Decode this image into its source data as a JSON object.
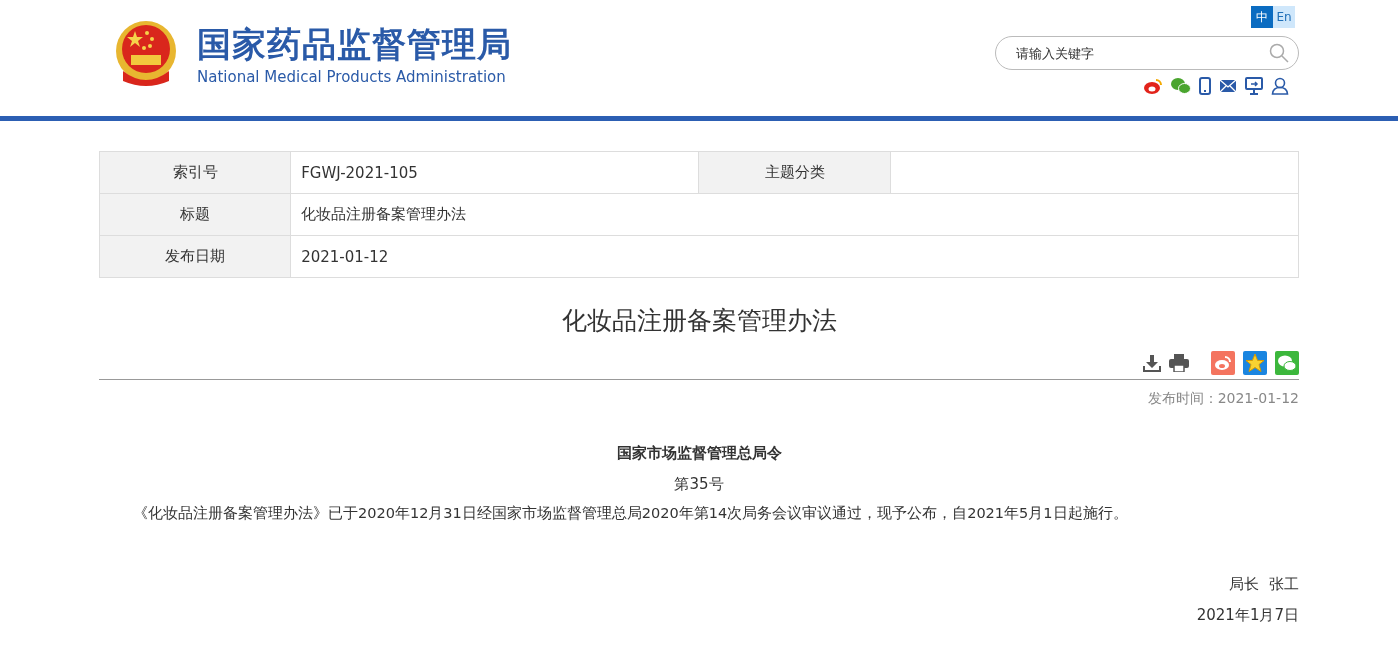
{
  "header": {
    "title_cn": "国家药品监督管理局",
    "title_en": "National Medical Products Administration",
    "languages": [
      {
        "label": "中",
        "selected": true
      },
      {
        "label": "En",
        "selected": false
      }
    ],
    "search": {
      "placeholder": "请输入关键字"
    }
  },
  "info_table": {
    "rows": [
      {
        "cells": [
          {
            "label": "索引号",
            "value": "FGWJ-2021-105"
          },
          {
            "label": "主题分类"
          }
        ]
      },
      {
        "cells": [
          {
            "label": "标题",
            "value": "化妆品注册备案管理办法"
          }
        ]
      },
      {
        "cells": [
          {
            "label": "发布日期",
            "value": "2021-01-12"
          }
        ]
      }
    ]
  },
  "article": {
    "title": "化妆品注册备案管理办法",
    "publish_time": "发布时间：2021-01-12",
    "order_title": "国家市场监督管理总局令",
    "order_number": "第35号",
    "paragraph": "《化妆品注册备案管理办法》已于2020年12月31日经国家市场监督管理总局2020年第14次局务会议审议通过，现予公布，自2021年5月1日起施行。",
    "signature": "局长  张工",
    "date": "2021年1月7日"
  }
}
